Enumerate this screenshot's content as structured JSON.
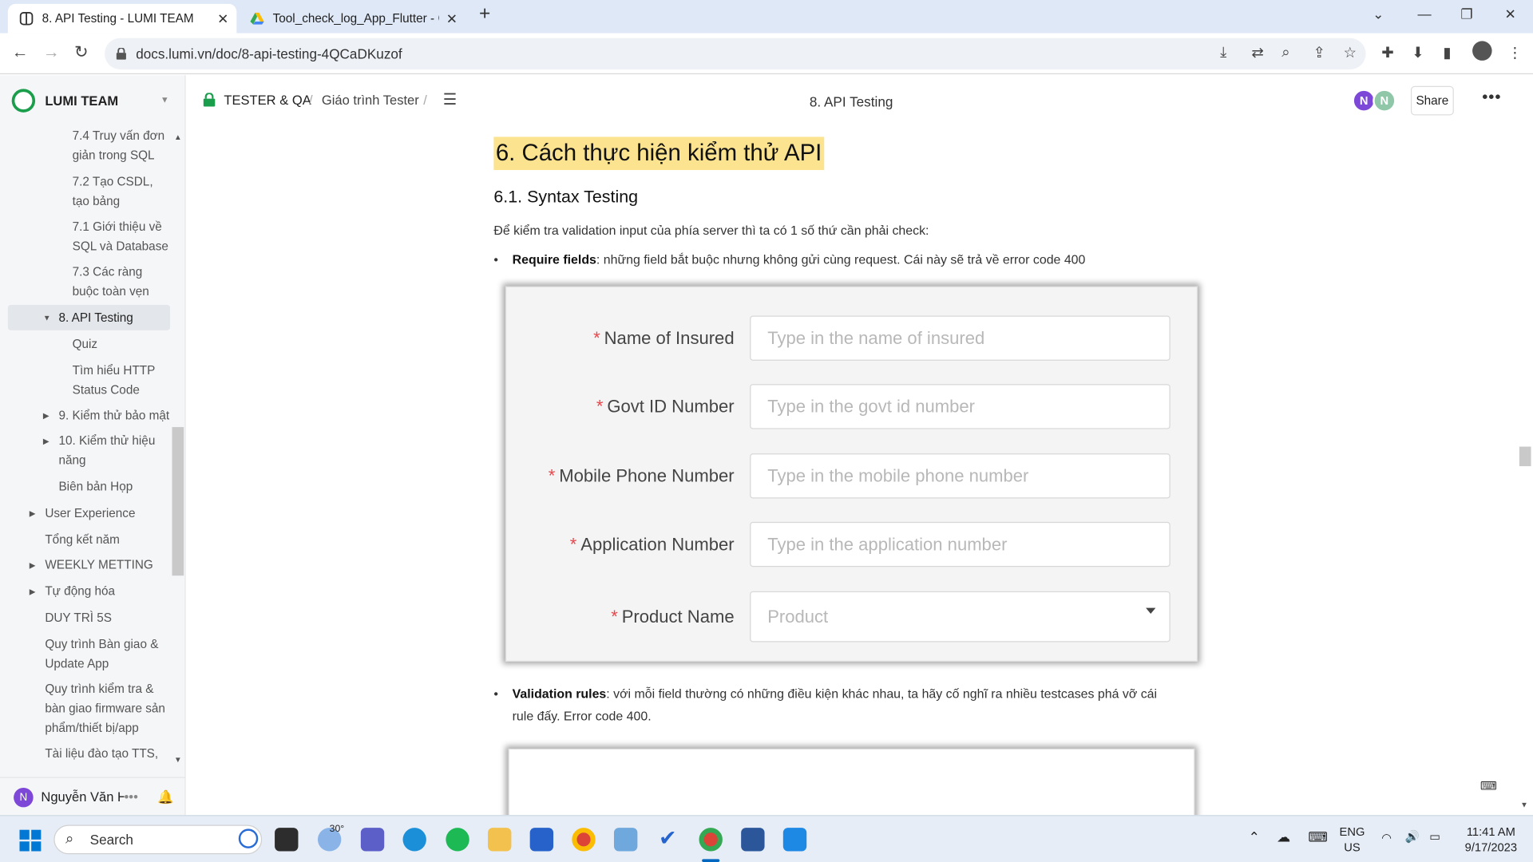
{
  "browser": {
    "tabs": [
      {
        "title": "8. API Testing - LUMI TEAM",
        "active": true
      },
      {
        "title": "Tool_check_log_App_Flutter - Go",
        "active": false
      }
    ],
    "url": "docs.lumi.vn/doc/8-api-testing-4QCaDKuzof"
  },
  "sidebar": {
    "workspace": "LUMI TEAM",
    "items": [
      {
        "label": "7.4 Truy vấn đơn giản trong SQL"
      },
      {
        "label": "7.2 Tạo CSDL, tạo bảng"
      },
      {
        "label": "7.1 Giới thiệu về SQL và Database"
      },
      {
        "label": "7.3 Các ràng buộc toàn vẹn"
      },
      {
        "label": "8. API Testing"
      },
      {
        "label": "Quiz"
      },
      {
        "label": "Tìm hiểu HTTP Status Code"
      },
      {
        "label": "9. Kiểm thử bảo mật"
      },
      {
        "label": "10. Kiểm thử hiệu năng"
      },
      {
        "label": "Biên bản Họp"
      },
      {
        "label": "User Experience"
      },
      {
        "label": "Tổng kết năm"
      },
      {
        "label": "WEEKLY METTING"
      },
      {
        "label": "Tự động hóa"
      },
      {
        "label": "DUY TRÌ 5S"
      },
      {
        "label": "Quy trình Bàn giao & Update App"
      },
      {
        "label": "Quy trình kiểm tra & bàn giao firmware sản phẩm/thiết bị/app"
      },
      {
        "label": "Tài liệu đào tạo TTS,"
      }
    ],
    "user": {
      "initial": "N",
      "name": "Nguyễn Văn H"
    }
  },
  "header": {
    "collection": "TESTER & QA",
    "parent": "Giáo trình Tester",
    "separator": "/",
    "title": "8. API Testing",
    "avatars": [
      "N",
      "N"
    ],
    "share": "Share"
  },
  "doc": {
    "h1": "6. Cách thực hiện kiểm thử API",
    "h2": "6.1. Syntax Testing",
    "intro": "Để kiểm tra validation input của phía server thì ta có 1 số thứ cần phải check:",
    "bullet1_bold": "Require fields",
    "bullet1_text": ": những field bắt buộc nhưng không gửi cùng request. Cái này sẽ trả về error code 400",
    "bullet2_bold": "Validation rules",
    "bullet2_text_line1": ": với mỗi field thường có những điều kiện khác nhau, ta hãy cố nghĩ ra nhiều testcases phá vỡ cái",
    "bullet2_text_line2": "rule đấy. Error code 400.",
    "form": [
      {
        "label": "Name of Insured",
        "placeholder": "Type in the name of insured"
      },
      {
        "label": "Govt ID Number",
        "placeholder": "Type in the govt id number"
      },
      {
        "label": "Mobile Phone Number",
        "placeholder": "Type in the mobile phone number"
      },
      {
        "label": "Application Number",
        "placeholder": "Type in the application number"
      },
      {
        "label": "Product Name",
        "placeholder": "Product"
      }
    ]
  },
  "taskbar": {
    "search": "Search",
    "weather": "30°",
    "lang_top": "ENG",
    "lang_bottom": "US",
    "time": "11:41 AM",
    "date": "9/17/2023"
  },
  "colors": {
    "highlight": "#fbe38f",
    "required": "#e5484d",
    "brand": "#1a9e4b",
    "avatar1": "#7d47d8",
    "avatar2": "#8fc7a8"
  }
}
